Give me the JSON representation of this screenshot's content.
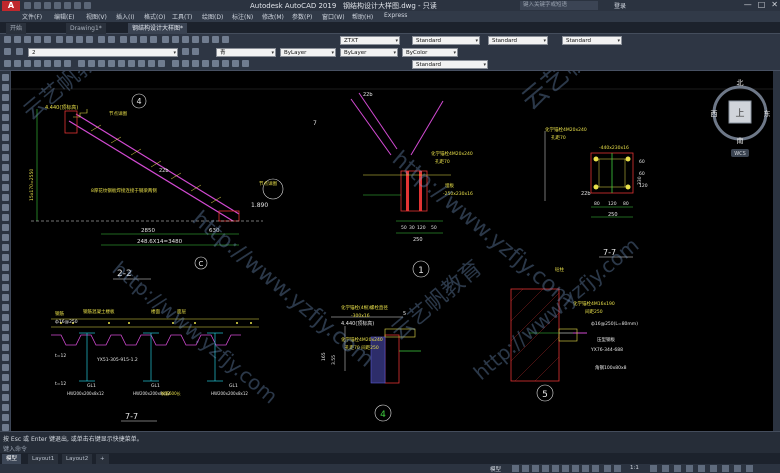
{
  "window": {
    "title": "Autodesk AutoCAD 2019",
    "document": "钢结构设计大样图.dwg - 只读",
    "search_placeholder": "键入关键字或短语",
    "login": "登录",
    "controls": [
      "—",
      "□",
      "✕"
    ]
  },
  "menu": {
    "items": [
      "文件(F)",
      "编辑(E)",
      "视图(V)",
      "插入(I)",
      "格式(O)",
      "工具(T)",
      "绘图(D)",
      "标注(N)",
      "修改(M)",
      "参数(P)",
      "窗口(W)",
      "帮助(H)",
      "Express"
    ]
  },
  "tabs": [
    {
      "label": "开始"
    },
    {
      "label": "Drawing1*"
    },
    {
      "label": "钢结构设计大样图*"
    }
  ],
  "toolbar": {
    "layer_value": "2",
    "text_style": "ZTXT",
    "dim_style": "Standard",
    "table_style": "Standard",
    "mleader_style": "Standard",
    "color_value": "青",
    "linetype_value": "ByLayer",
    "lineweight_value": "ByLayer",
    "plotstyle_value": "ByColor",
    "visual_style": "Standard"
  },
  "viewcube": {
    "north": "北",
    "south": "南",
    "east": "东",
    "west": "西",
    "center": "上",
    "wcs": "WCS"
  },
  "drawing": {
    "details": {
      "d1_title": "2-2",
      "d1_callout_top": "4",
      "d1_callout_bottom": "C",
      "d1_label_1": "节点详图",
      "d1_label_2": "节点详图",
      "d1_label_3": "8厚花纹钢板焊接连接于钢梁两侧",
      "d1_elev_top": "4.440(顶标高)",
      "d1_elev_bottom": "1.890",
      "d1_dim_vertical": "15x170=2550",
      "d1_dim_1": "2850",
      "d1_dim_2": "630",
      "d1_dim_3": "248.6X14=3480",
      "d1_tag": "22b",
      "d2_callout": "1",
      "d2_tag": "22b",
      "d2_level": "7",
      "d2_note_1": "化学锚栓4M20x240",
      "d2_note_2": "孔距70",
      "d2_note_3": "埋板",
      "d2_note_4": "-250x230x16",
      "d2_dims": [
        "50",
        "30",
        "120",
        "50"
      ],
      "d2_total": "250",
      "d3_title": "7-7",
      "d3_note_1": "化学锚栓4M20x240",
      "d3_note_2": "孔距70",
      "d3_note_3": "-440x230x16",
      "d3_tag": "22b",
      "d3_dims": [
        "80",
        "120",
        "80"
      ],
      "d3_total": "250",
      "d3_dim_v": [
        "60",
        "60",
        "120"
      ],
      "d3_side_dim": "330",
      "d4_title": "7-7",
      "d4_label_1": "钢筋混凝土楼板",
      "d4_label_2": "楼面",
      "d4_label_3": "面层",
      "d4_label_4": "钢筋",
      "d4_note_1": "YX51-305-915-1.2",
      "d4_note_2": "ф16@250",
      "d4_note_3": "t=12",
      "d4_gl_1": "GL1",
      "d4_gl_2": "GL1",
      "d4_gl_3": "GL1",
      "d4_beam_1": "HW200x200x8x12",
      "d4_beam_2": "HW200x200x8x12",
      "d4_beam_3": "HW200x200x8x12",
      "d4_note_5": "t=12",
      "d4_note_6": "钢筋600长",
      "d5_callout": "4",
      "d5_elev": "4.440(顶标高)",
      "d5_note_1": "化学锚栓(4根)螺栓直径",
      "d5_note_2": "-300x16",
      "d5_note_3": "化学锚栓4M20x240",
      "d5_note_4": "孔距70 间距250",
      "d5_dim_1": "165",
      "d5_dim_2": "3.55",
      "d5_dim_3": "5",
      "d6_callout": "5",
      "d6_note_1": "化学锚栓4M16x190",
      "d6_note_2": "间距250",
      "d6_note_3": "ф16@250(L=80mm)",
      "d6_note_4": "YX76-344-688",
      "d6_note_5": "压型钢板",
      "d6_note_6": "角钢100x80x8",
      "d6_note_7": "砼柱"
    }
  },
  "watermark": {
    "url": "http://www.yzfjy.com",
    "brand": "云艺帆教育"
  },
  "command": {
    "history": "按 Esc 或 Enter 键退出, 或单击右键显示快捷菜单。",
    "prompt": "键入命令"
  },
  "layouts": [
    "模型",
    "Layout1",
    "Layout2",
    "+"
  ],
  "status": {
    "model": "模型",
    "scale": "1:1"
  },
  "colors": {
    "accent_red": "#c0282d",
    "canvas": "#000000",
    "line_cyan": "#25c9d9",
    "line_yellow": "#e9e04a",
    "line_green": "#3fcf3f",
    "line_magenta": "#d24ad2",
    "line_red": "#e23434",
    "line_white": "#e6e6e6"
  }
}
